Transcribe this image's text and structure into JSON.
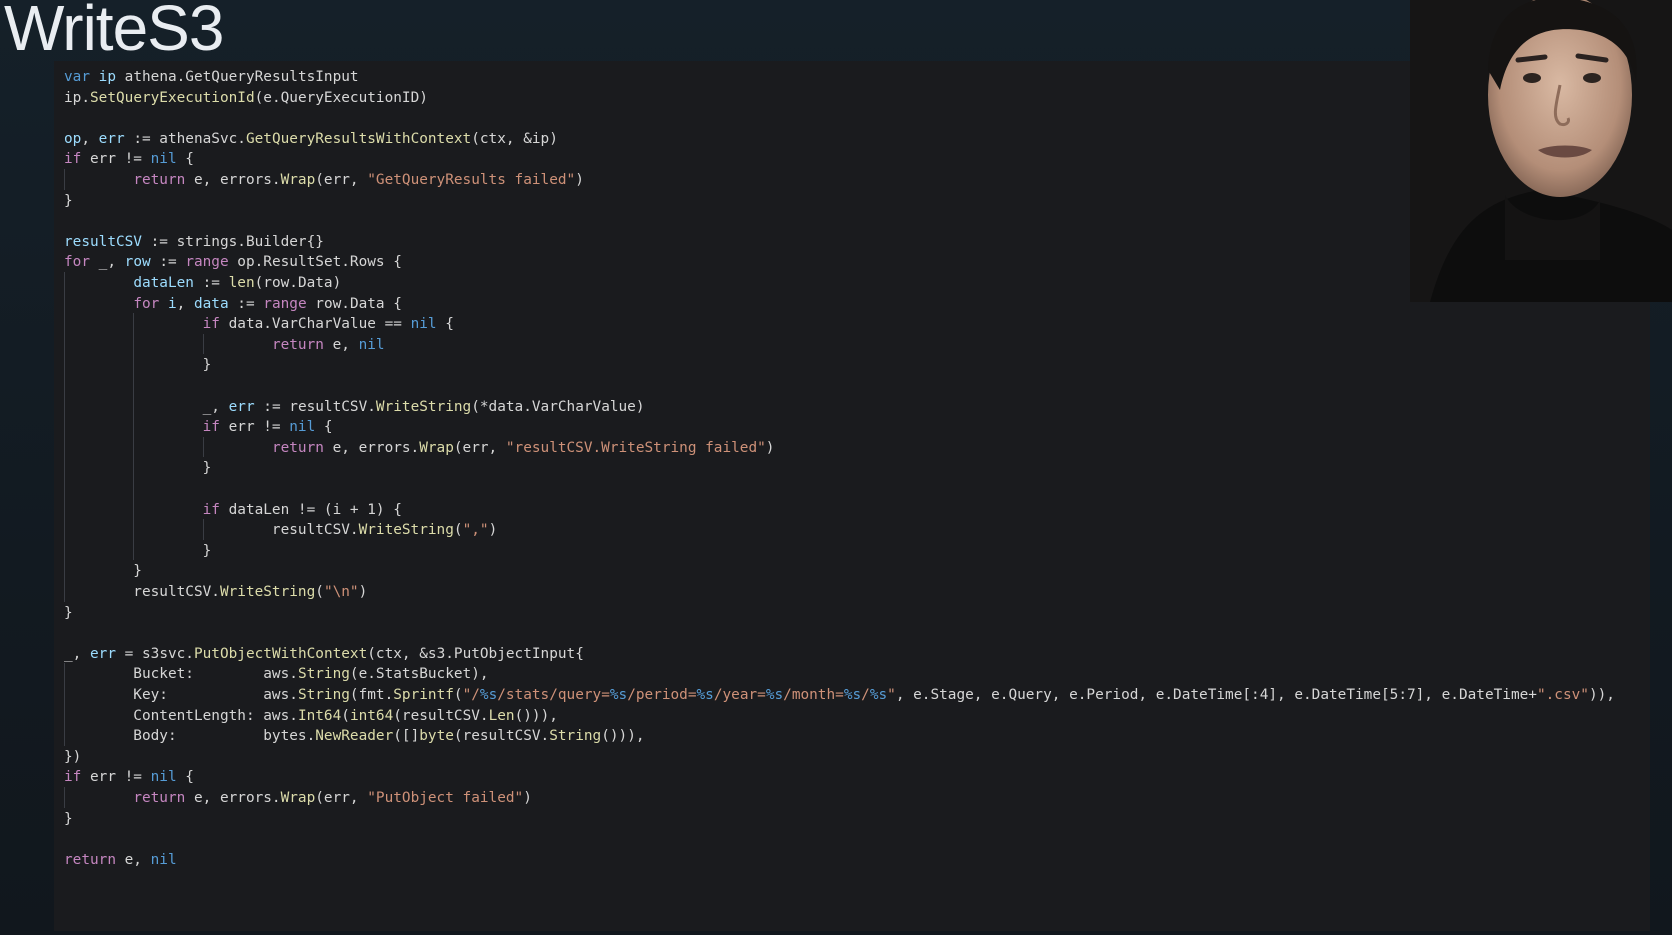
{
  "slide": {
    "title": "WriteS3"
  },
  "colors": {
    "keyword": "#569cd6",
    "control": "#c586c0",
    "function": "#dcdcaa",
    "variable": "#9cdcfe",
    "string": "#ce9178",
    "plain": "#d6d6d6",
    "editor_background": "#1a1b1e",
    "slide_background": "#141b22"
  },
  "webcam": {
    "icon": "presenter-face"
  },
  "code": {
    "language": "go",
    "lines": [
      {
        "tokens": [
          {
            "t": "var",
            "c": "kw"
          },
          {
            "t": " "
          },
          {
            "t": "ip",
            "c": "var"
          },
          {
            "t": " athena.GetQueryResultsInput"
          }
        ]
      },
      {
        "tokens": [
          {
            "t": "ip."
          },
          {
            "t": "SetQueryExecutionId",
            "c": "fn"
          },
          {
            "t": "(e.QueryExecutionID)"
          }
        ]
      },
      {
        "tokens": []
      },
      {
        "tokens": [
          {
            "t": "op",
            "c": "var"
          },
          {
            "t": ", "
          },
          {
            "t": "err",
            "c": "var"
          },
          {
            "t": " := athenaSvc."
          },
          {
            "t": "GetQueryResultsWithContext",
            "c": "fn"
          },
          {
            "t": "(ctx, &ip)"
          }
        ]
      },
      {
        "tokens": [
          {
            "t": "if",
            "c": "ctl"
          },
          {
            "t": " err != "
          },
          {
            "t": "nil",
            "c": "kw"
          },
          {
            "t": " {"
          }
        ]
      },
      {
        "tokens": [
          {
            "t": "        "
          },
          {
            "t": "return",
            "c": "ctl"
          },
          {
            "t": " e, errors."
          },
          {
            "t": "Wrap",
            "c": "fn"
          },
          {
            "t": "(err, "
          },
          {
            "t": "\"GetQueryResults failed\"",
            "c": "str"
          },
          {
            "t": ")"
          }
        ]
      },
      {
        "tokens": [
          {
            "t": "}"
          }
        ]
      },
      {
        "tokens": []
      },
      {
        "tokens": [
          {
            "t": "resultCSV",
            "c": "var"
          },
          {
            "t": " := strings.Builder{}"
          }
        ]
      },
      {
        "tokens": [
          {
            "t": "for",
            "c": "ctl"
          },
          {
            "t": " _, "
          },
          {
            "t": "row",
            "c": "var"
          },
          {
            "t": " := "
          },
          {
            "t": "range",
            "c": "ctl"
          },
          {
            "t": " op.ResultSet.Rows {"
          }
        ]
      },
      {
        "tokens": [
          {
            "t": "        "
          },
          {
            "t": "dataLen",
            "c": "var"
          },
          {
            "t": " := "
          },
          {
            "t": "len",
            "c": "fn"
          },
          {
            "t": "(row.Data)"
          }
        ]
      },
      {
        "tokens": [
          {
            "t": "        "
          },
          {
            "t": "for",
            "c": "ctl"
          },
          {
            "t": " "
          },
          {
            "t": "i",
            "c": "var"
          },
          {
            "t": ", "
          },
          {
            "t": "data",
            "c": "var"
          },
          {
            "t": " := "
          },
          {
            "t": "range",
            "c": "ctl"
          },
          {
            "t": " row.Data {"
          }
        ]
      },
      {
        "tokens": [
          {
            "t": "                "
          },
          {
            "t": "if",
            "c": "ctl"
          },
          {
            "t": " data.VarCharValue == "
          },
          {
            "t": "nil",
            "c": "kw"
          },
          {
            "t": " {"
          }
        ]
      },
      {
        "tokens": [
          {
            "t": "                        "
          },
          {
            "t": "return",
            "c": "ctl"
          },
          {
            "t": " e, "
          },
          {
            "t": "nil",
            "c": "kw"
          }
        ]
      },
      {
        "tokens": [
          {
            "t": "                }"
          }
        ]
      },
      {
        "tokens": []
      },
      {
        "tokens": [
          {
            "t": "                _, "
          },
          {
            "t": "err",
            "c": "var"
          },
          {
            "t": " := resultCSV."
          },
          {
            "t": "WriteString",
            "c": "fn"
          },
          {
            "t": "(*data.VarCharValue)"
          }
        ]
      },
      {
        "tokens": [
          {
            "t": "                "
          },
          {
            "t": "if",
            "c": "ctl"
          },
          {
            "t": " err != "
          },
          {
            "t": "nil",
            "c": "kw"
          },
          {
            "t": " {"
          }
        ]
      },
      {
        "tokens": [
          {
            "t": "                        "
          },
          {
            "t": "return",
            "c": "ctl"
          },
          {
            "t": " e, errors."
          },
          {
            "t": "Wrap",
            "c": "fn"
          },
          {
            "t": "(err, "
          },
          {
            "t": "\"resultCSV.WriteString failed\"",
            "c": "str"
          },
          {
            "t": ")"
          }
        ]
      },
      {
        "tokens": [
          {
            "t": "                }"
          }
        ]
      },
      {
        "tokens": []
      },
      {
        "tokens": [
          {
            "t": "                "
          },
          {
            "t": "if",
            "c": "ctl"
          },
          {
            "t": " dataLen != (i + 1) {"
          }
        ]
      },
      {
        "tokens": [
          {
            "t": "                        resultCSV."
          },
          {
            "t": "WriteString",
            "c": "fn"
          },
          {
            "t": "("
          },
          {
            "t": "\",\"",
            "c": "str"
          },
          {
            "t": ")"
          }
        ]
      },
      {
        "tokens": [
          {
            "t": "                }"
          }
        ]
      },
      {
        "tokens": [
          {
            "t": "        }"
          }
        ]
      },
      {
        "tokens": [
          {
            "t": "        resultCSV."
          },
          {
            "t": "WriteString",
            "c": "fn"
          },
          {
            "t": "("
          },
          {
            "t": "\"\\n\"",
            "c": "str"
          },
          {
            "t": ")"
          }
        ]
      },
      {
        "tokens": [
          {
            "t": "}"
          }
        ]
      },
      {
        "tokens": []
      },
      {
        "tokens": [
          {
            "t": "_, "
          },
          {
            "t": "err",
            "c": "var"
          },
          {
            "t": " = s3svc."
          },
          {
            "t": "PutObjectWithContext",
            "c": "fn"
          },
          {
            "t": "(ctx, &s3.PutObjectInput{"
          }
        ]
      },
      {
        "tokens": [
          {
            "t": "        Bucket:        aws."
          },
          {
            "t": "String",
            "c": "fn"
          },
          {
            "t": "(e.StatsBucket),"
          }
        ]
      },
      {
        "tokens": [
          {
            "t": "        Key:           aws."
          },
          {
            "t": "String",
            "c": "fn"
          },
          {
            "t": "(fmt."
          },
          {
            "t": "Sprintf",
            "c": "fn"
          },
          {
            "t": "("
          },
          {
            "t": "\"/",
            "c": "str"
          },
          {
            "t": "%s",
            "c": "fmt"
          },
          {
            "t": "/stats/query=",
            "c": "str"
          },
          {
            "t": "%s",
            "c": "fmt"
          },
          {
            "t": "/period=",
            "c": "str"
          },
          {
            "t": "%s",
            "c": "fmt"
          },
          {
            "t": "/year=",
            "c": "str"
          },
          {
            "t": "%s",
            "c": "fmt"
          },
          {
            "t": "/month=",
            "c": "str"
          },
          {
            "t": "%s",
            "c": "fmt"
          },
          {
            "t": "/",
            "c": "str"
          },
          {
            "t": "%s",
            "c": "fmt"
          },
          {
            "t": "\"",
            "c": "str"
          },
          {
            "t": ", e.Stage, e.Query, e.Period, e.DateTime[:4], e.DateTime[5:7], e.DateTime+"
          },
          {
            "t": "\".csv\"",
            "c": "str"
          },
          {
            "t": ")),"
          }
        ]
      },
      {
        "tokens": [
          {
            "t": "        ContentLength: aws."
          },
          {
            "t": "Int64",
            "c": "fn"
          },
          {
            "t": "("
          },
          {
            "t": "int64",
            "c": "fn"
          },
          {
            "t": "(resultCSV."
          },
          {
            "t": "Len",
            "c": "fn"
          },
          {
            "t": "())),"
          }
        ]
      },
      {
        "tokens": [
          {
            "t": "        Body:          bytes."
          },
          {
            "t": "NewReader",
            "c": "fn"
          },
          {
            "t": "([]"
          },
          {
            "t": "byte",
            "c": "fn"
          },
          {
            "t": "(resultCSV."
          },
          {
            "t": "String",
            "c": "fn"
          },
          {
            "t": "())),"
          }
        ]
      },
      {
        "tokens": [
          {
            "t": "})"
          }
        ]
      },
      {
        "tokens": [
          {
            "t": "if",
            "c": "ctl"
          },
          {
            "t": " err != "
          },
          {
            "t": "nil",
            "c": "kw"
          },
          {
            "t": " {"
          }
        ]
      },
      {
        "tokens": [
          {
            "t": "        "
          },
          {
            "t": "return",
            "c": "ctl"
          },
          {
            "t": " e, errors."
          },
          {
            "t": "Wrap",
            "c": "fn"
          },
          {
            "t": "(err, "
          },
          {
            "t": "\"PutObject failed\"",
            "c": "str"
          },
          {
            "t": ")"
          }
        ]
      },
      {
        "tokens": [
          {
            "t": "}"
          }
        ]
      },
      {
        "tokens": []
      },
      {
        "tokens": [
          {
            "t": "return",
            "c": "ctl"
          },
          {
            "t": " e, "
          },
          {
            "t": "nil",
            "c": "kw"
          }
        ]
      }
    ]
  }
}
